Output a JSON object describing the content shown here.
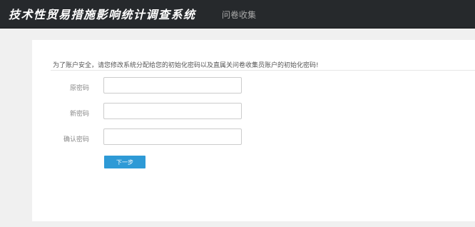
{
  "header": {
    "title": "技术性贸易措施影响统计调查系统",
    "nav_item": "问卷收集"
  },
  "form": {
    "notice": "为了账户安全，请您修改系统分配给您的初始化密码以及直属关问卷收集员账户的初始化密码!",
    "fields": [
      {
        "label": "原密码",
        "value": ""
      },
      {
        "label": "新密码",
        "value": ""
      },
      {
        "label": "确认密码",
        "value": ""
      }
    ],
    "next_label": "下一步"
  },
  "colors": {
    "header_bg": "#26292c",
    "page_bg": "#f0f0f0",
    "button_bg": "#2e9ad6"
  }
}
